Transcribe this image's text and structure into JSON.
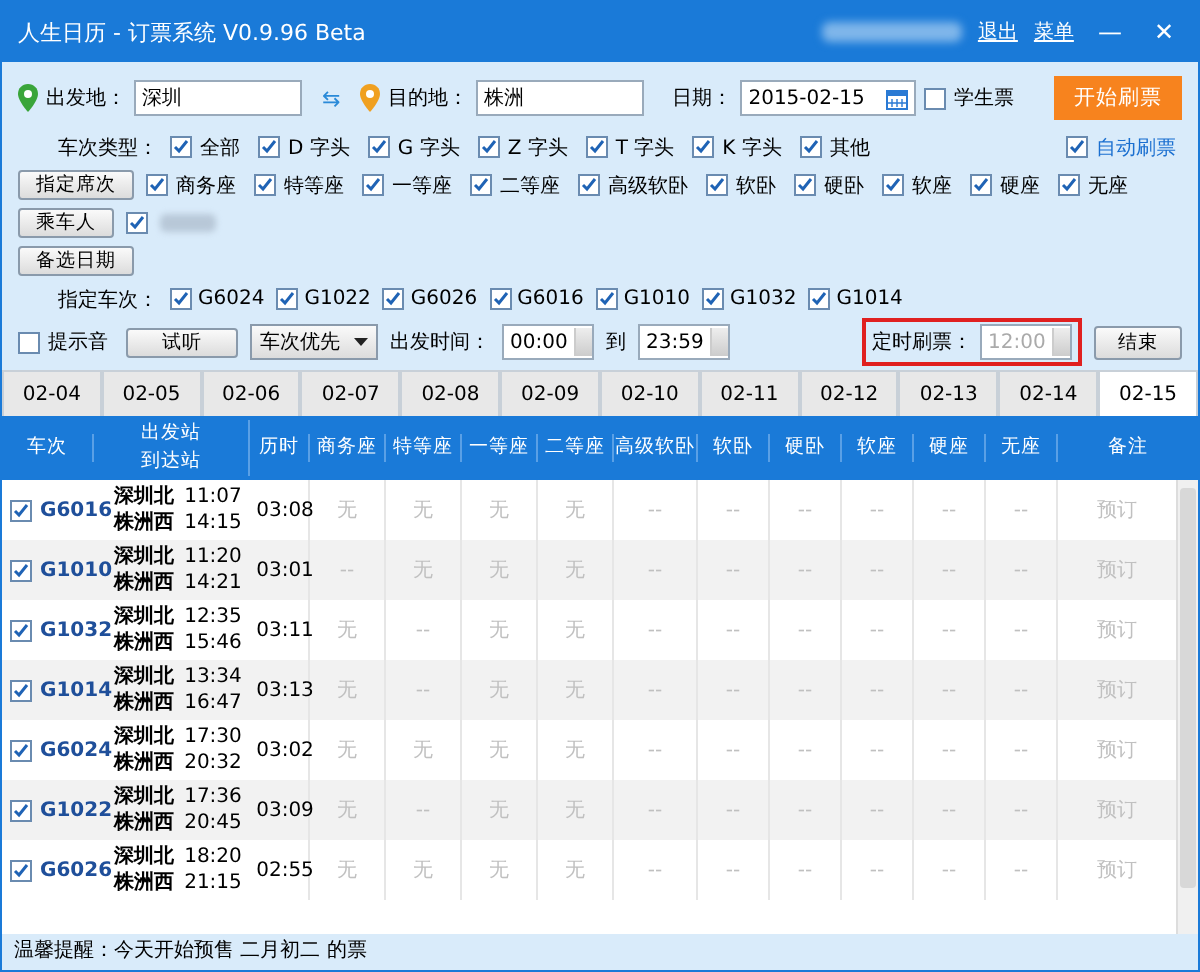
{
  "window": {
    "title": "人生日历 - 订票系统 V0.9.96 Beta",
    "links": [
      "退出",
      "菜单"
    ],
    "controls": [
      "—",
      "✕"
    ]
  },
  "route": {
    "from_label": "出发地：",
    "from": "深圳",
    "swap": "⇆",
    "to_label": "目的地：",
    "to": "株洲",
    "date_label": "日期：",
    "date": "2015-02-15",
    "student": {
      "label": "学生票",
      "checked": false
    },
    "start_button": "开始刷票"
  },
  "train_types": {
    "label": "车次类型：",
    "items": [
      {
        "label": "全部",
        "checked": true
      },
      {
        "label": "D 字头",
        "checked": true
      },
      {
        "label": "G 字头",
        "checked": true
      },
      {
        "label": "Z 字头",
        "checked": true
      },
      {
        "label": "T 字头",
        "checked": true
      },
      {
        "label": "K 字头",
        "checked": true
      },
      {
        "label": "其他",
        "checked": true
      }
    ],
    "auto": {
      "label": "自动刷票",
      "checked": true
    }
  },
  "seats": {
    "button": "指定席次",
    "items": [
      {
        "label": "商务座",
        "checked": true
      },
      {
        "label": "特等座",
        "checked": true
      },
      {
        "label": "一等座",
        "checked": true
      },
      {
        "label": "二等座",
        "checked": true
      },
      {
        "label": "高级软卧",
        "checked": true
      },
      {
        "label": "软卧",
        "checked": true
      },
      {
        "label": "硬卧",
        "checked": true
      },
      {
        "label": "软座",
        "checked": true
      },
      {
        "label": "硬座",
        "checked": true
      },
      {
        "label": "无座",
        "checked": true
      }
    ]
  },
  "passenger": {
    "button": "乘车人",
    "checked": true
  },
  "alt_dates": {
    "button": "备选日期"
  },
  "trains": {
    "label": "指定车次：",
    "items": [
      {
        "label": "G6024",
        "checked": true
      },
      {
        "label": "G1022",
        "checked": true
      },
      {
        "label": "G6026",
        "checked": true
      },
      {
        "label": "G6016",
        "checked": true
      },
      {
        "label": "G1010",
        "checked": true
      },
      {
        "label": "G1032",
        "checked": true
      },
      {
        "label": "G1014",
        "checked": true
      }
    ]
  },
  "options": {
    "sound": {
      "label": "提示音",
      "checked": false
    },
    "listen": "试听",
    "priority": "车次优先",
    "time_label": "出发时间：",
    "time_from": "00:00",
    "to_label": "到",
    "time_to": "23:59",
    "timer_label": "定时刷票：",
    "timer": "12:00",
    "timer_disabled": true,
    "end_button": "结束"
  },
  "date_tabs": [
    {
      "label": "02-04",
      "selected": false
    },
    {
      "label": "02-05",
      "selected": false
    },
    {
      "label": "02-06",
      "selected": false
    },
    {
      "label": "02-07",
      "selected": false
    },
    {
      "label": "02-08",
      "selected": false
    },
    {
      "label": "02-09",
      "selected": false
    },
    {
      "label": "02-10",
      "selected": false
    },
    {
      "label": "02-11",
      "selected": false
    },
    {
      "label": "02-12",
      "selected": false
    },
    {
      "label": "02-13",
      "selected": false
    },
    {
      "label": "02-14",
      "selected": false
    },
    {
      "label": "02-15",
      "selected": true
    }
  ],
  "table": {
    "columns": [
      "车次",
      [
        "出发站",
        "到达站"
      ],
      "历时",
      "商务座",
      "特等座",
      "一等座",
      "二等座",
      "高级软卧",
      "软卧",
      "硬卧",
      "软座",
      "硬座",
      "无座",
      "备注"
    ],
    "rows": [
      {
        "checked": true,
        "train": "G6016",
        "from": "深圳北",
        "depart": "11:07",
        "to": "株洲西",
        "arrive": "14:15",
        "duration": "03:08",
        "seats": [
          "无",
          "无",
          "无",
          "无",
          "--",
          "--",
          "--",
          "--",
          "--",
          "--"
        ],
        "action": "预订"
      },
      {
        "checked": true,
        "train": "G1010",
        "from": "深圳北",
        "depart": "11:20",
        "to": "株洲西",
        "arrive": "14:21",
        "duration": "03:01",
        "seats": [
          "--",
          "无",
          "无",
          "无",
          "--",
          "--",
          "--",
          "--",
          "--",
          "--"
        ],
        "action": "预订"
      },
      {
        "checked": true,
        "train": "G1032",
        "from": "深圳北",
        "depart": "12:35",
        "to": "株洲西",
        "arrive": "15:46",
        "duration": "03:11",
        "seats": [
          "无",
          "--",
          "无",
          "无",
          "--",
          "--",
          "--",
          "--",
          "--",
          "--"
        ],
        "action": "预订"
      },
      {
        "checked": true,
        "train": "G1014",
        "from": "深圳北",
        "depart": "13:34",
        "to": "株洲西",
        "arrive": "16:47",
        "duration": "03:13",
        "seats": [
          "无",
          "--",
          "无",
          "无",
          "--",
          "--",
          "--",
          "--",
          "--",
          "--"
        ],
        "action": "预订"
      },
      {
        "checked": true,
        "train": "G6024",
        "from": "深圳北",
        "depart": "17:30",
        "to": "株洲西",
        "arrive": "20:32",
        "duration": "03:02",
        "seats": [
          "无",
          "无",
          "无",
          "无",
          "--",
          "--",
          "--",
          "--",
          "--",
          "--"
        ],
        "action": "预订"
      },
      {
        "checked": true,
        "train": "G1022",
        "from": "深圳北",
        "depart": "17:36",
        "to": "株洲西",
        "arrive": "20:45",
        "duration": "03:09",
        "seats": [
          "无",
          "--",
          "无",
          "无",
          "--",
          "--",
          "--",
          "--",
          "--",
          "--"
        ],
        "action": "预订"
      },
      {
        "checked": true,
        "train": "G6026",
        "from": "深圳北",
        "depart": "18:20",
        "to": "株洲西",
        "arrive": "21:15",
        "duration": "02:55",
        "seats": [
          "无",
          "无",
          "无",
          "无",
          "--",
          "--",
          "--",
          "--",
          "--",
          "--"
        ],
        "action": "预订"
      }
    ]
  },
  "status_bar": "温馨提醒：今天开始预售 二月初二 的票"
}
